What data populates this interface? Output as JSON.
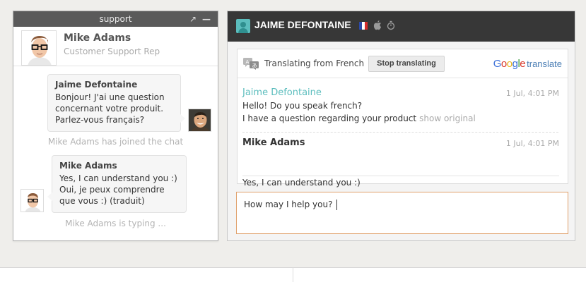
{
  "widget": {
    "title": "support",
    "popout_glyph": "↗",
    "minimize_glyph": "—",
    "agent": {
      "name": "Mike Adams",
      "role": "Customer Support Rep"
    },
    "messages": [
      {
        "author": "Jaime Defontaine",
        "text": "Bonjour! J'ai une question concernant votre produit. Parlez-vous français?"
      },
      {
        "author": "Mike Adams",
        "text": "Yes, I can understand you :) Oui, je peux comprendre que vous :) (traduit)"
      }
    ],
    "joined_text": "Mike Adams has joined the chat",
    "typing_text": "Mike Adams is typing ..."
  },
  "console": {
    "customer_name": "JAIME DEFONTAINE",
    "icons": [
      "user-icon",
      "france-flag-icon",
      "apple-icon",
      "clock-icon"
    ],
    "translate": {
      "label": "Translating from French",
      "stop_label": "Stop translating",
      "brand_letters": [
        "G",
        "o",
        "o",
        "g",
        "l",
        "e"
      ],
      "brand_colors": [
        "#3a6fd8",
        "#d8382a",
        "#e8b51a",
        "#3a6fd8",
        "#3a9b3f",
        "#d8382a"
      ],
      "brand_word": "translate"
    },
    "messages": [
      {
        "author": "Jaime Defontaine",
        "time": "1 Jul, 4:01 PM",
        "lines": [
          "Hello! Do you speak french?",
          "I have a question regarding your product"
        ],
        "link": "show original"
      },
      {
        "author": "Mike Adams",
        "time": "1 Jul, 4:01 PM",
        "lines": [
          "Yes, I can understand you :)"
        ]
      }
    ],
    "input_value": "How may I help you?"
  },
  "colors": {
    "accent_teal": "#5bbdbd",
    "header_dark": "#373737",
    "input_border": "#e0a06a"
  }
}
